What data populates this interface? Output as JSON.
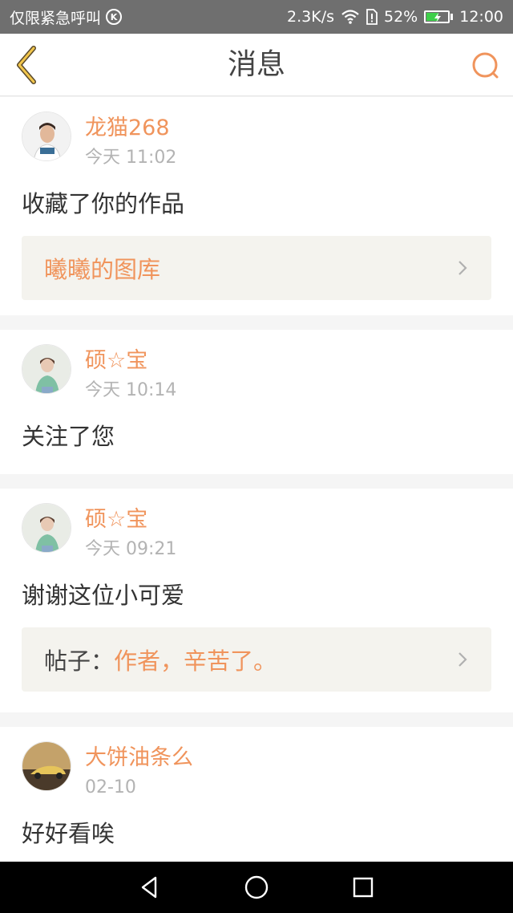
{
  "status_bar": {
    "carrier": "仅限紧急呼叫",
    "network_speed": "2.3K/s",
    "battery_percent": "52%",
    "battery_level": 0.52,
    "time": "12:00"
  },
  "header": {
    "title": "消息"
  },
  "colors": {
    "accent": "#f0945c",
    "back_arrow": "#f2c64c",
    "status_bar": "#6f6f6f",
    "quote_bg": "#f4f3ee"
  },
  "messages": [
    {
      "username": "龙猫268",
      "time": "今天 11:02",
      "text": "收藏了你的作品",
      "quote": {
        "prefix": "",
        "text": "曦曦的图库"
      }
    },
    {
      "username": "硕☆宝",
      "time": "今天 10:14",
      "text": "关注了您"
    },
    {
      "username": "硕☆宝",
      "time": "今天 09:21",
      "text": "谢谢这位小可爱",
      "quote": {
        "prefix": "帖子：",
        "text": "作者，辛苦了。"
      }
    },
    {
      "username": "大饼油条么",
      "time": "02-10",
      "text": "好好看唉"
    }
  ],
  "icons": {
    "back": "chevron-left-icon",
    "search": "search-icon",
    "nav_back": "triangle-back-icon",
    "nav_home": "circle-home-icon",
    "nav_recents": "square-recents-icon"
  }
}
